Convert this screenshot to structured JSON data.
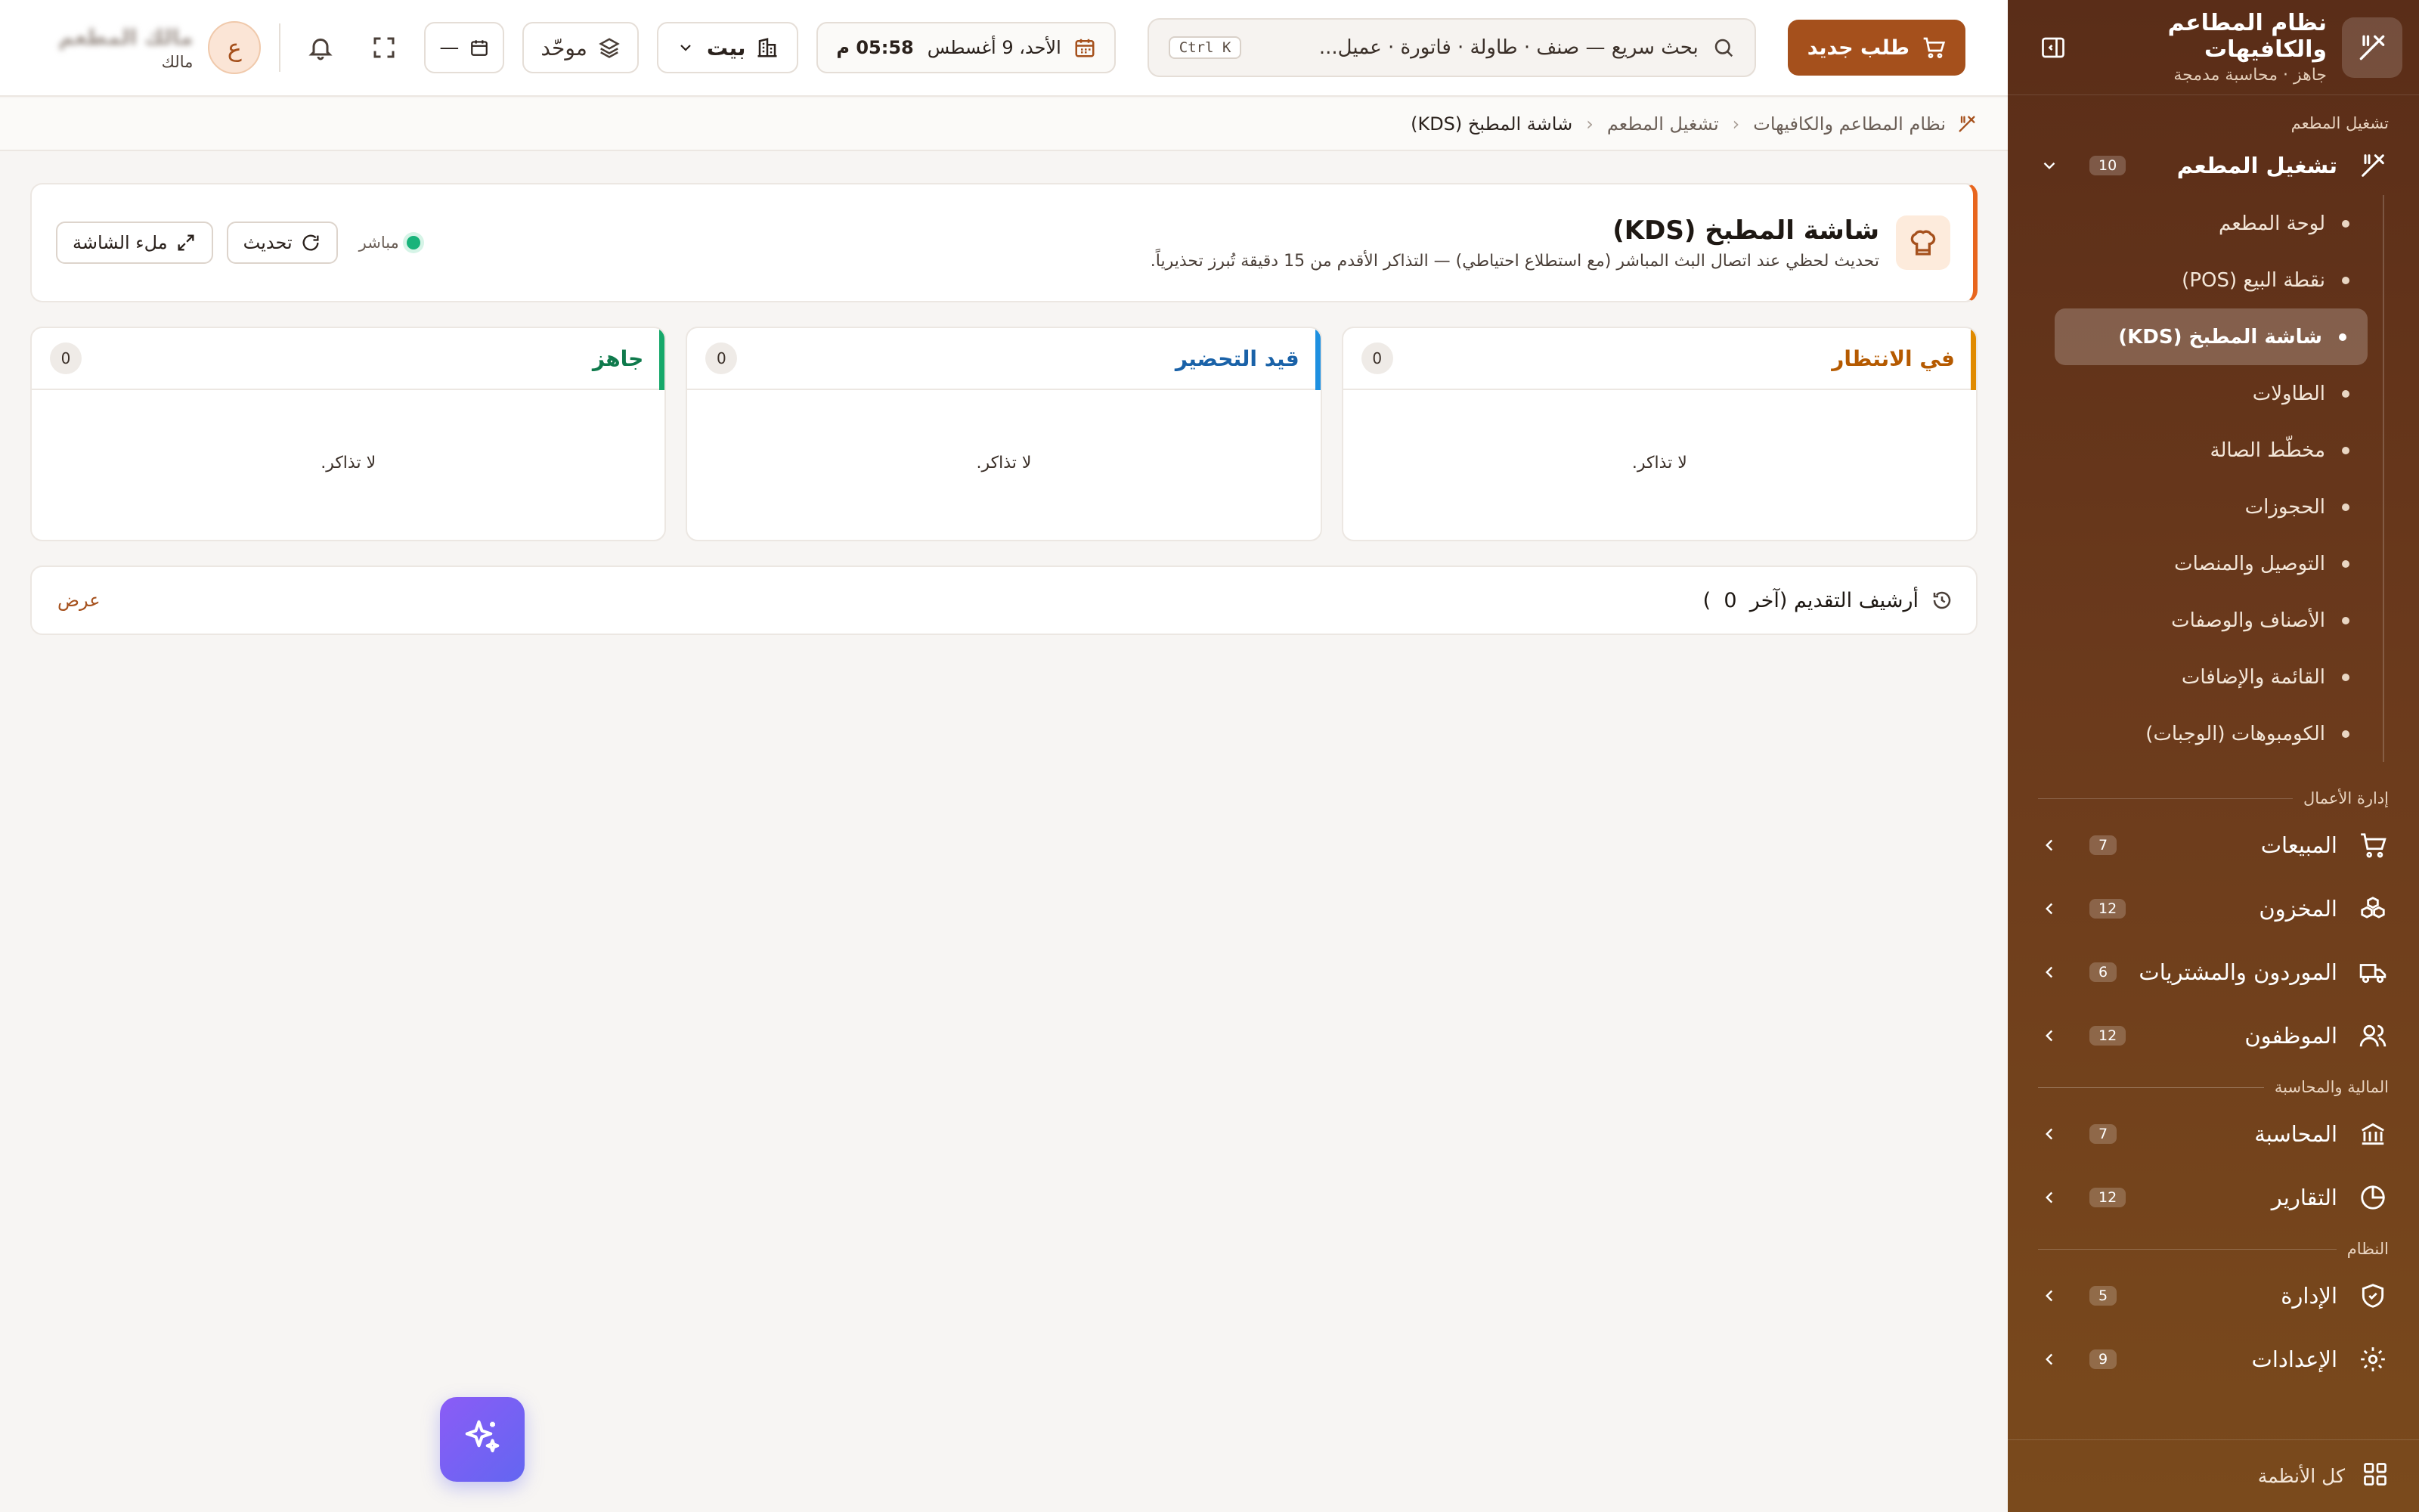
{
  "sidebar": {
    "brand_title": "نظام المطاعم والكافيهات",
    "brand_sub": "جاهز · محاسبة مدمجة",
    "sections": {
      "ops": "تشغيل المطعم",
      "business": "إدارة الأعمال",
      "finance": "المالية والمحاسبة",
      "system": "النظام"
    },
    "ops_group": {
      "label": "تشغيل المطعم",
      "count": "10",
      "icon": "utensils-icon"
    },
    "ops_items": [
      {
        "label": "لوحة المطعم"
      },
      {
        "label": "نقطة البيع (POS)"
      },
      {
        "label": "شاشة المطبخ (KDS)"
      },
      {
        "label": "الطاولات"
      },
      {
        "label": "مخطّط الصالة"
      },
      {
        "label": "الحجوزات"
      },
      {
        "label": "التوصيل والمنصات"
      },
      {
        "label": "الأصناف والوصفات"
      },
      {
        "label": "القائمة والإضافات"
      },
      {
        "label": "الكومبوهات (الوجبات)"
      }
    ],
    "groups": [
      {
        "label": "المبيعات",
        "count": "7"
      },
      {
        "label": "المخزون",
        "count": "12"
      },
      {
        "label": "الموردون والمشتريات",
        "count": "6"
      },
      {
        "label": "الموظفون",
        "count": "12"
      },
      {
        "label": "المحاسبة",
        "count": "7"
      },
      {
        "label": "التقارير",
        "count": "12"
      },
      {
        "label": "الإدارة",
        "count": "5"
      },
      {
        "label": "الإعدادات",
        "count": "9"
      }
    ],
    "footer_label": "كل الأنظمة"
  },
  "topbar": {
    "new_order": "طلب جديد",
    "search_placeholder": "بحث سريع — صنف · طاولة · فاتورة · عميل...",
    "search_kbd": "Ctrl K",
    "date": "الأحد، 9 أغسطس",
    "time": "05:58 م",
    "branch": "بيت",
    "mode": "موحّد",
    "calendar_value": "—",
    "avatar_letter": "ع",
    "user_name": "مالك المطعم",
    "user_role": "مالك"
  },
  "breadcrumb": {
    "root": "نظام المطاعم والكافيهات",
    "section": "تشغيل المطعم",
    "current": "شاشة المطبخ (KDS)"
  },
  "hero": {
    "title": "شاشة المطبخ (KDS)",
    "description": "تحديث لحظي عند اتصال البث المباشر (مع استطلاع احتياطي) — التذاكر الأقدم من 15 دقيقة تُبرز تحذيرياً.",
    "live_label": "مباشر",
    "refresh_label": "تحديث",
    "fullscreen_label": "ملء الشاشة"
  },
  "columns": [
    {
      "title": "في الانتظار",
      "count": "0",
      "empty": "لا تذاكر.",
      "color": "#e08a00",
      "title_color": "#b55a00"
    },
    {
      "title": "قيد التحضير",
      "count": "0",
      "empty": "لا تذاكر.",
      "color": "#1e90e0",
      "title_color": "#1a62a8"
    },
    {
      "title": "جاهز",
      "count": "0",
      "empty": "لا تذاكر.",
      "color": "#16a86a",
      "title_color": "#0f7a4c"
    }
  ],
  "archive": {
    "label": "أرشيف التقديم (آخر",
    "count": "0",
    "close": ")",
    "view": "عرض"
  },
  "colors": {
    "accent": "#a5501c",
    "sidebar_bg": "#6b3a1c",
    "live": "#18b37a"
  }
}
